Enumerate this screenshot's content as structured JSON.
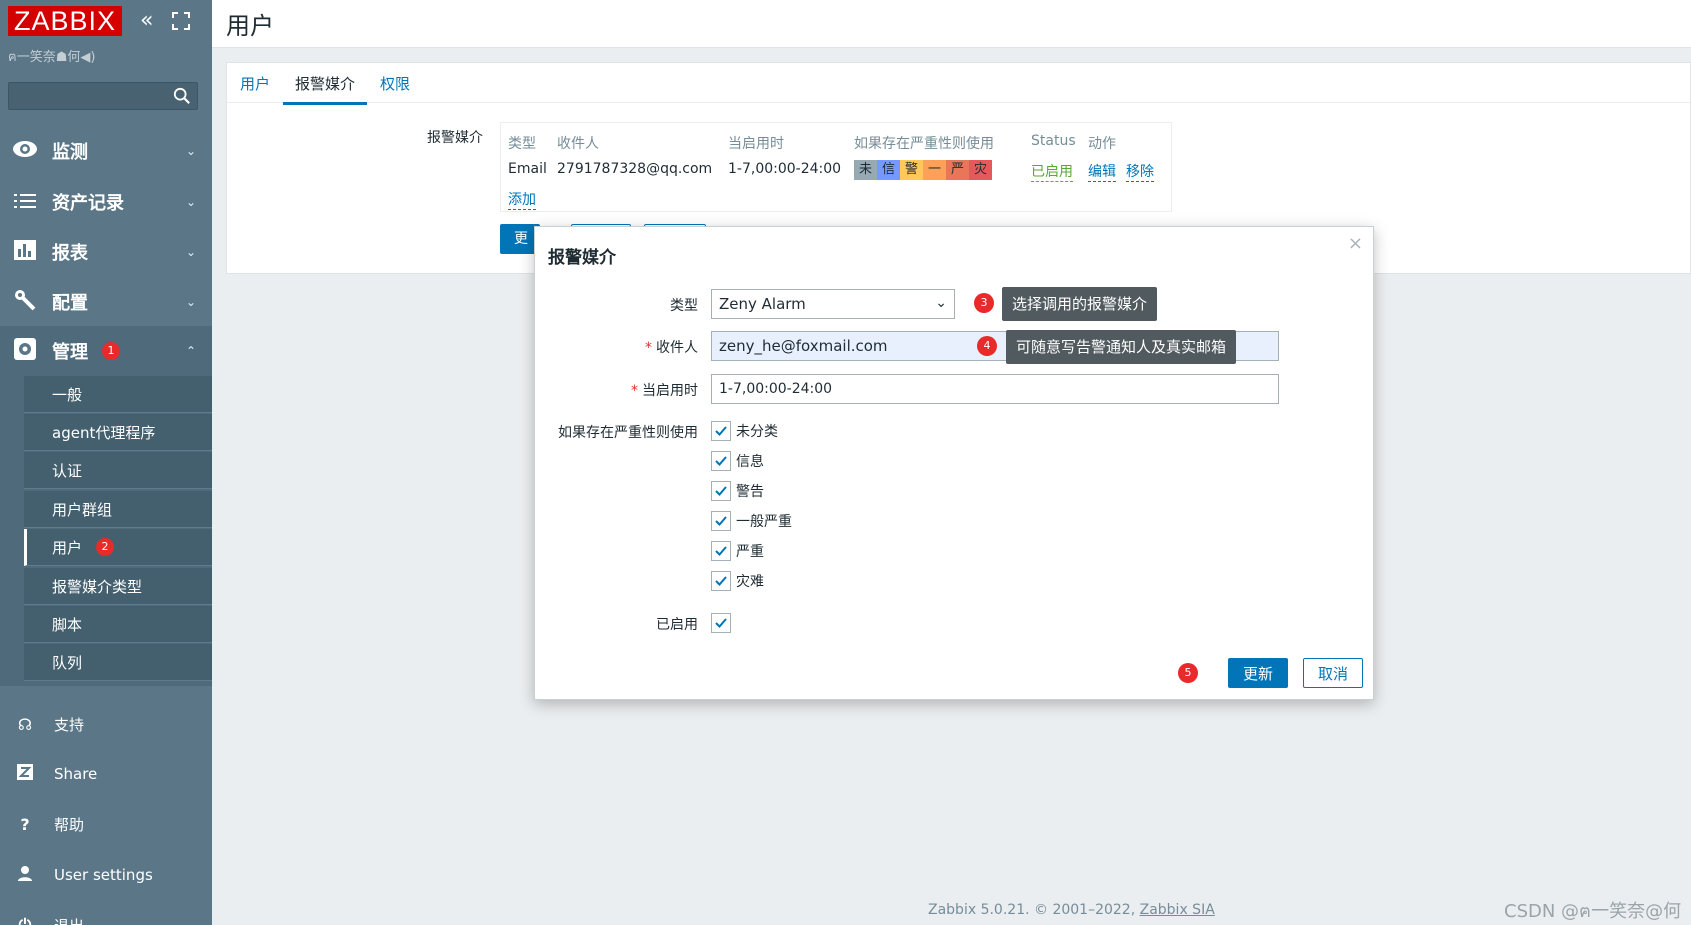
{
  "sidebar": {
    "logo": "ZABBIX",
    "collapse_icon": "«",
    "user_line": "ฅ一笑奈☗何◀)",
    "main_nav": [
      {
        "label": "监测",
        "icon": "eye-icon"
      },
      {
        "label": "资产记录",
        "icon": "list-icon"
      },
      {
        "label": "报表",
        "icon": "bar-chart-icon"
      },
      {
        "label": "配置",
        "icon": "wrench-icon"
      },
      {
        "label": "管理",
        "icon": "gear-icon",
        "badge": "1"
      }
    ],
    "sub_nav": [
      {
        "label": "一般"
      },
      {
        "label": "agent代理程序"
      },
      {
        "label": "认证"
      },
      {
        "label": "用户群组"
      },
      {
        "label": "用户",
        "badge": "2"
      },
      {
        "label": "报警媒介类型"
      },
      {
        "label": "脚本"
      },
      {
        "label": "队列"
      }
    ],
    "bottom_nav": [
      {
        "label": "支持",
        "icon": "headset-icon"
      },
      {
        "label": "Share",
        "icon": "share-z-icon"
      },
      {
        "label": "帮助",
        "icon": "question-icon"
      },
      {
        "label": "User settings",
        "icon": "user-icon"
      },
      {
        "label": "退出",
        "icon": "power-icon"
      }
    ]
  },
  "page": {
    "title": "用户",
    "tabs": [
      "用户",
      "报警媒介",
      "权限"
    ],
    "media_label": "报警媒介",
    "media_table": {
      "headers": [
        "类型",
        "收件人",
        "当启用时",
        "如果存在严重性则使用",
        "Status",
        "动作"
      ],
      "row": {
        "type": "Email",
        "sendto": "2791787328@qq.com",
        "period": "1-7,00:00-24:00",
        "severities": [
          "未",
          "信",
          "警",
          "一",
          "严",
          "灾"
        ],
        "status": "已启用",
        "edit": "编辑",
        "remove": "移除"
      },
      "add": "添加"
    },
    "bg_update_partial": "更"
  },
  "modal": {
    "title": "报警媒介",
    "close": "×",
    "type_label": "类型",
    "type_value": "Zeny Alarm",
    "sendto_label": "收件人",
    "sendto_value": "zeny_he@foxmail.com",
    "period_label": "当启用时",
    "period_value": "1-7,00:00-24:00",
    "severity_label": "如果存在严重性则使用",
    "severities": [
      "未分类",
      "信息",
      "警告",
      "一般严重",
      "严重",
      "灾难"
    ],
    "enabled_label": "已启用",
    "update": "更新",
    "cancel": "取消"
  },
  "annotations": {
    "n3": "3",
    "tip3": "选择调用的报警媒介",
    "n4": "4",
    "tip4": "可随意写告警通知人及真实邮箱",
    "n5": "5"
  },
  "footer": {
    "text": "Zabbix 5.0.21. © 2001–2022, ",
    "link": "Zabbix SIA"
  },
  "watermark": "CSDN @ฅ一笑奈@何",
  "colors": {
    "sidebar": "#5a7687",
    "accent": "#0275b8",
    "logo": "#d40000",
    "badge": "#e82a2a",
    "enabled": "#59a735",
    "sev_not_classified": "#97aab3",
    "sev_information": "#7499ff",
    "sev_warning": "#ffc859",
    "sev_average": "#ffa059",
    "sev_high": "#e97659",
    "sev_disaster": "#e45959"
  }
}
